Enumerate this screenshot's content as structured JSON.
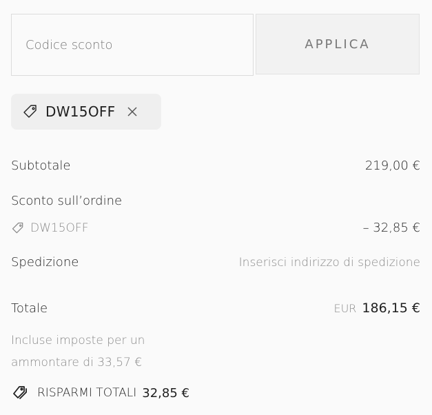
{
  "discount": {
    "placeholder": "Codice sconto",
    "apply_label": "APPLICA",
    "applied_code": "DW15OFF",
    "remove_icon": "close-icon",
    "tag_icon": "tag-icon"
  },
  "summary": {
    "subtotal_label": "Subtotale",
    "subtotal_value": "219,00 €",
    "order_discount_label": "Sconto sull’ordine",
    "discount_code": "DW15OFF",
    "discount_value": "– 32,85 €",
    "shipping_label": "Spedizione",
    "shipping_value": "Inserisci indirizzo di spedizione",
    "total_label": "Totale",
    "total_currency": "EUR",
    "total_value": "186,15 €",
    "tax_note": "Incluse imposte per un ammontare di 33,57 €",
    "savings_label": "RISPARMI TOTALI",
    "savings_value": "32,85 €",
    "savings_icon": "tags-icon"
  },
  "colors": {
    "background": "#fafafa",
    "text": "#1f1f1f",
    "muted": "#8a8a8a",
    "chip": "#efefef",
    "button": "#f2f2f2"
  }
}
